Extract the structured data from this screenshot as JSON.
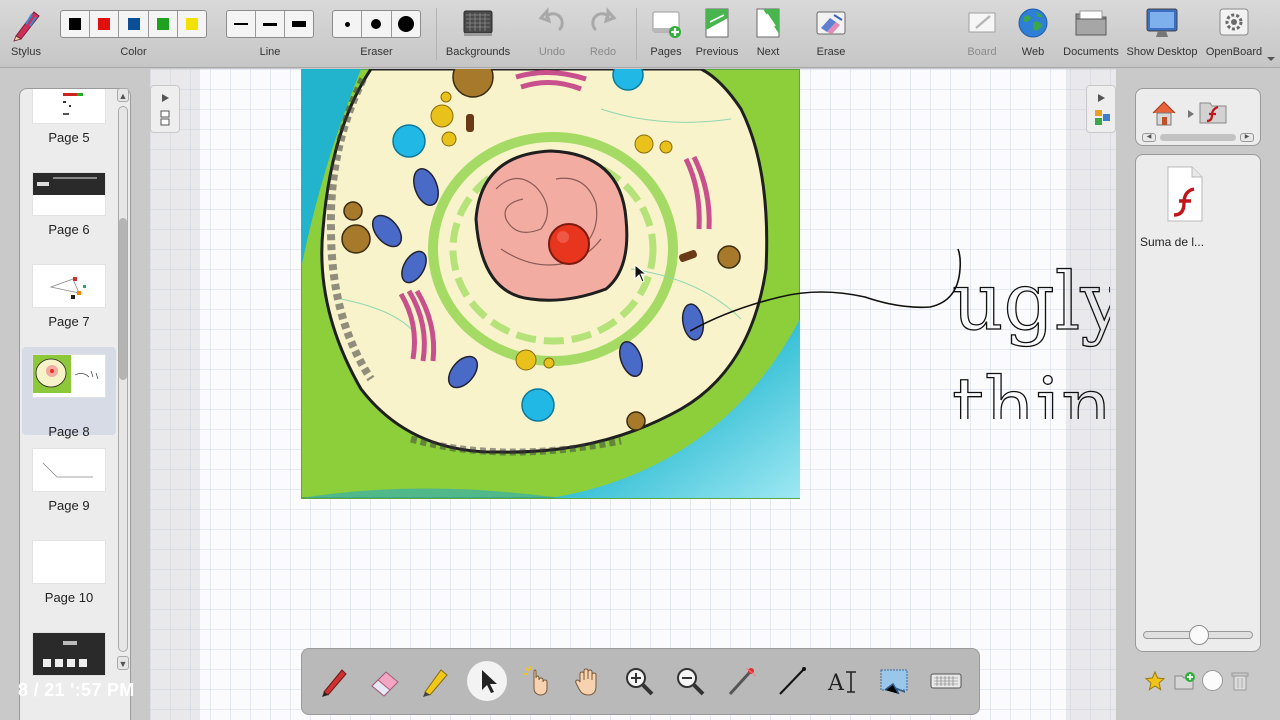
{
  "toolbar": {
    "stylus": "Stylus",
    "color": "Color",
    "line": "Line",
    "eraser": "Eraser",
    "backgrounds": "Backgrounds",
    "undo": "Undo",
    "redo": "Redo",
    "pages": "Pages",
    "previous": "Previous",
    "next": "Next",
    "erase": "Erase",
    "board": "Board",
    "web": "Web",
    "documents": "Documents",
    "show_desktop": "Show Desktop",
    "openboard": "OpenBoard"
  },
  "colors": [
    "#000000",
    "#e01010",
    "#0a4f95",
    "#1fa01f",
    "#f2e200"
  ],
  "pages": [
    {
      "label": "Page 5"
    },
    {
      "label": "Page 6"
    },
    {
      "label": "Page 7"
    },
    {
      "label": "Page 8",
      "selected": true
    },
    {
      "label": "Page 9"
    },
    {
      "label": "Page 10"
    }
  ],
  "clock": "8 / 21 ':57 PM",
  "library": {
    "item_label": "Suma de l...",
    "item_icon": "flash-file-icon"
  },
  "board": {
    "annotation_line1": "ugly",
    "annotation_line2": "thing",
    "image": "animal-cell-illustration"
  },
  "palette": {
    "active_tool": "selector",
    "tools": [
      "pen",
      "eraser",
      "highlighter",
      "selector",
      "interact",
      "hand",
      "zoom-in",
      "zoom-out",
      "laser-pointer",
      "line",
      "text",
      "capture",
      "keyboard"
    ]
  }
}
